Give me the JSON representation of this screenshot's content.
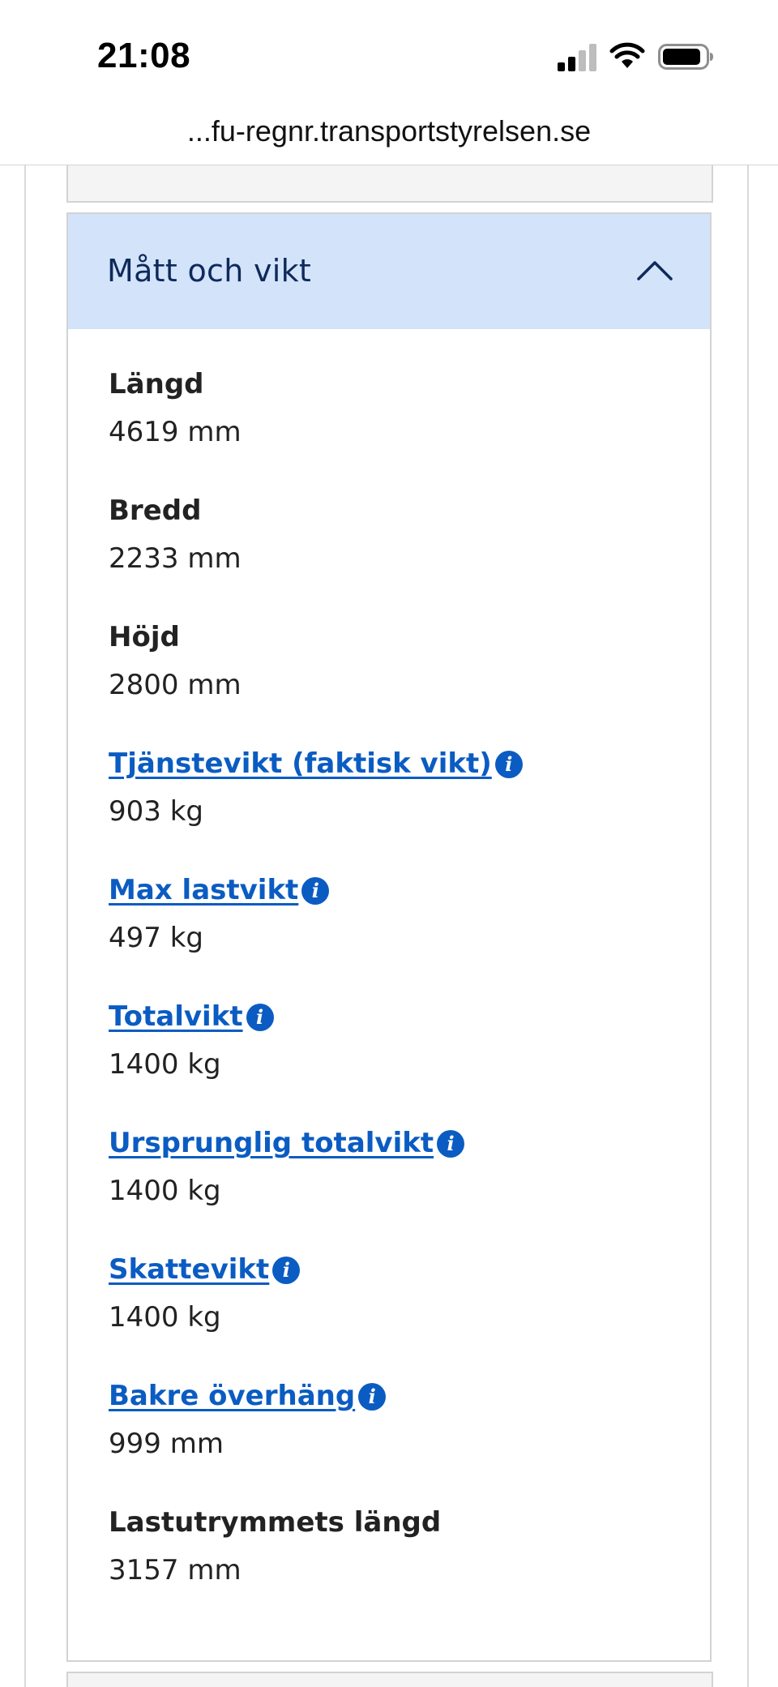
{
  "status_bar": {
    "time": "21:08",
    "icons": [
      "cellular-signal-icon",
      "wifi-icon",
      "battery-icon"
    ]
  },
  "browser": {
    "url": "...fu-regnr.transportstyrelsen.se"
  },
  "accordion": {
    "title": "Mått och vikt",
    "expanded": true,
    "toggle_icon": "chevron-up-icon",
    "fields": [
      {
        "label": "Längd",
        "value": "4619 mm",
        "link": false
      },
      {
        "label": "Bredd",
        "value": "2233 mm",
        "link": false
      },
      {
        "label": "Höjd",
        "value": "2800 mm",
        "link": false
      },
      {
        "label": "Tjänstevikt (faktisk vikt)",
        "value": "903 kg",
        "link": true,
        "info_icon": "i"
      },
      {
        "label": "Max lastvikt",
        "value": "497 kg",
        "link": true,
        "info_icon": "i"
      },
      {
        "label": "Totalvikt",
        "value": "1400 kg",
        "link": true,
        "info_icon": "i"
      },
      {
        "label": "Ursprunglig totalvikt",
        "value": "1400 kg",
        "link": true,
        "info_icon": "i"
      },
      {
        "label": "Skattevikt",
        "value": "1400 kg",
        "link": true,
        "info_icon": "i"
      },
      {
        "label": "Bakre överhäng",
        "value": "999 mm",
        "link": true,
        "info_icon": "i"
      },
      {
        "label": "Lastutrymmets längd",
        "value": "3157 mm",
        "link": false
      }
    ]
  },
  "colors": {
    "accordion_header_bg": "#d3e3fa",
    "accordion_title": "#0e2a5a",
    "link": "#0b5cc2",
    "text": "#222222",
    "border": "#d3d3d3"
  }
}
